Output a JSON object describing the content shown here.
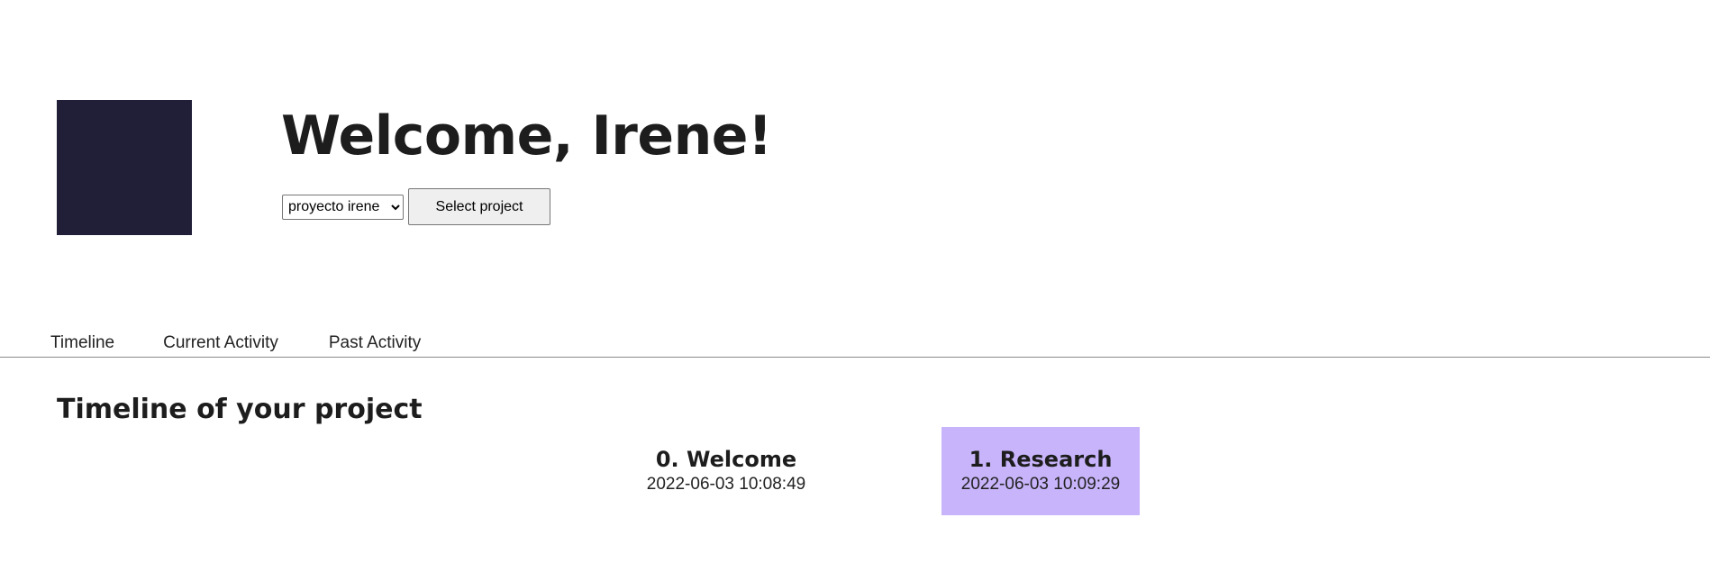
{
  "header": {
    "welcome_title": "Welcome, Irene!",
    "project_select": {
      "selected": "proyecto irene"
    },
    "select_button_label": "Select project"
  },
  "tabs": [
    {
      "label": "Timeline"
    },
    {
      "label": "Current Activity"
    },
    {
      "label": "Past Activity"
    }
  ],
  "timeline": {
    "heading": "Timeline of your project",
    "stages": [
      {
        "title": "0. Welcome",
        "date": "2022-06-03 10:08:49",
        "active": false
      },
      {
        "title": "1. Research",
        "date": "2022-06-03 10:09:29",
        "active": true
      }
    ]
  },
  "colors": {
    "logo": "#211f38",
    "active_stage": "#c8b4fa"
  }
}
